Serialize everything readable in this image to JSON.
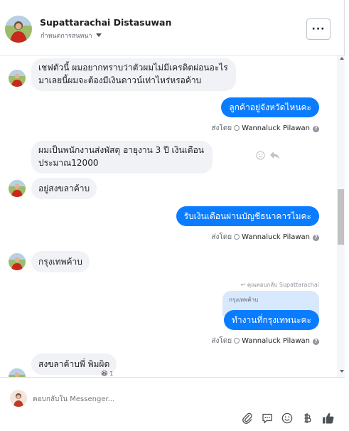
{
  "header": {
    "name": "Supattarachai Distasuwan",
    "subtitle": "กำหนดการสนทนา",
    "more_label": "···"
  },
  "messages": [
    {
      "id": "m1",
      "direction": "in",
      "lines": [
        "เชฟตัวนี้ ผมอยากทราบว่าตัวผมไม่มีเครดิตผ่อนอะไร",
        "มาเลยนี้ผมจะต้องมีเงินดาวน์เท่าไหร่หรอค้าบ"
      ]
    },
    {
      "id": "m2",
      "direction": "out",
      "text": "ลูกค้าอยู่จังหวัดไหนคะ"
    },
    {
      "id": "m3",
      "direction": "in",
      "lines": [
        "ผมเป็นพนักงานส่งพัสดุ อายุงาน 3 ปี เงินเดือน",
        "ประมาณ12000"
      ]
    },
    {
      "id": "m4",
      "direction": "in",
      "text": "อยู่สงขลาค้าบ"
    },
    {
      "id": "m5",
      "direction": "out",
      "text": "รับเงินเดือนผ่านบัญชีธนาคารไมคะ"
    },
    {
      "id": "m6",
      "direction": "in",
      "text": "กรุงเทพค้าบ"
    },
    {
      "id": "m7",
      "direction": "out",
      "text": "ทำงานที่กรุงเทพนะคะ"
    },
    {
      "id": "m8",
      "direction": "in",
      "text": "สงขลาค้าบพี่ พิมผิด"
    }
  ],
  "sent_by": {
    "label": "ส่งโดย",
    "agent": "Wannaluck Pilawan",
    "help": "?"
  },
  "reply_note": "คุณตอบกลับ Supattarachai",
  "quoted_text": "กรุงเทพค้าบ",
  "reaction": {
    "emoji": "😆",
    "count": "1"
  },
  "composer": {
    "placeholder": "ตอบกลับใน Messenger..."
  },
  "icons": [
    "more-icon",
    "smile-icon",
    "reply-icon",
    "paperclip-icon",
    "saved-reply-icon",
    "emoji-icon",
    "baht-icon",
    "thumbs-up-icon",
    "scroll-up-icon",
    "scroll-down-icon"
  ],
  "colors": {
    "outgoing_bubble": "#0a7cff",
    "incoming_bubble": "#f0f2f5",
    "quoted_bubble": "#d8e8fd",
    "thumbs_up": "#4b4f56"
  }
}
